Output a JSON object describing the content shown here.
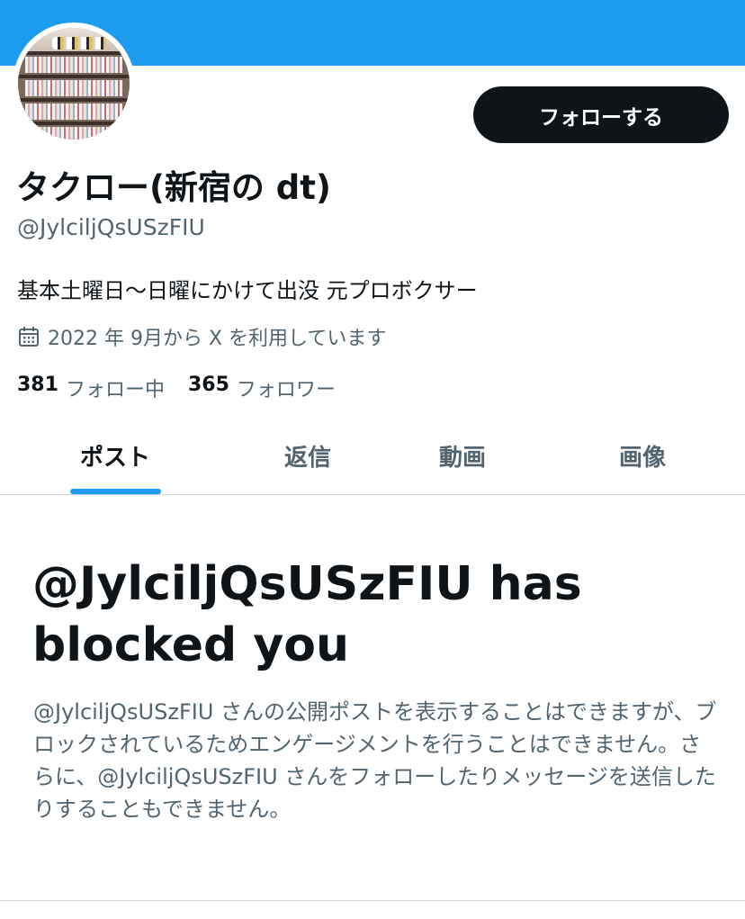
{
  "header": {
    "banner_color": "#1d9bf0",
    "follow_button_label": "フォローする"
  },
  "profile": {
    "display_name": "タクロー(新宿の dt)",
    "handle": "@JylciljQsUSzFIU",
    "bio": "基本土曜日〜日曜にかけて出没 元プロボクサー",
    "joined_text": "2022 年 9月から X を利用しています",
    "joined_icon": "calendar-icon",
    "following_count": "381",
    "following_label": "フォロー中",
    "followers_count": "365",
    "followers_label": "フォロワー"
  },
  "tabs": [
    {
      "label": "ポスト",
      "active": true
    },
    {
      "label": "返信",
      "active": false
    },
    {
      "label": "動画",
      "active": false
    },
    {
      "label": "画像",
      "active": false
    }
  ],
  "blocked": {
    "title": "@JylciljQsUSzFIU has blocked you",
    "description": "@JylciljQsUSzFIU さんの公開ポストを表示することはできますが、ブロックされているためエンゲージメントを行うことはできません。さらに、@JylciljQsUSzFIU さんをフォローしたりメッセージを送信したりすることもできません。"
  },
  "colors": {
    "accent": "#1d9bf0",
    "text_primary": "#0f1419",
    "text_secondary": "#536471"
  }
}
